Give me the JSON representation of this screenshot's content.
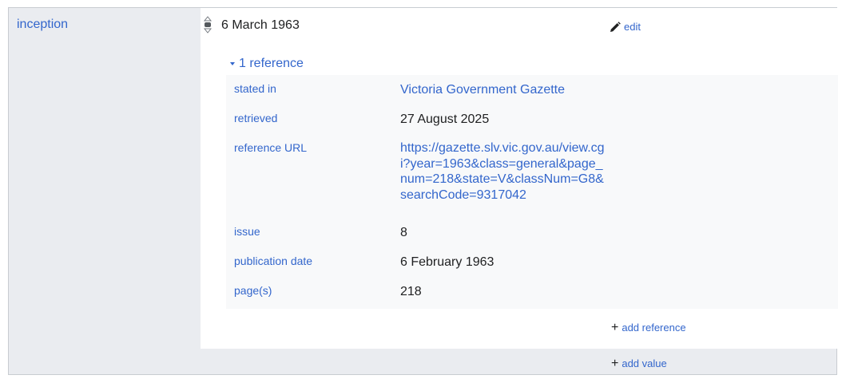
{
  "property": {
    "label": "inception"
  },
  "statement": {
    "value": "6 March 1963",
    "edit_label": "edit"
  },
  "references": {
    "toggle_label": "1 reference",
    "snaks": [
      {
        "property": "stated in",
        "value": "Victoria Government Gazette"
      },
      {
        "property": "retrieved",
        "value": "27 August 2025"
      },
      {
        "property": "reference URL",
        "value": "https://gazette.slv.vic.gov.au/view.cgi?year=1963&class=general&page_num=218&state=V&classNum=G8&searchCode=9317042"
      },
      {
        "property": "issue",
        "value": "8"
      },
      {
        "property": "publication date",
        "value": "6 February 1963"
      },
      {
        "property": "page(s)",
        "value": "218"
      }
    ],
    "add_reference_label": "add reference"
  },
  "add_value_label": "add value",
  "colors": {
    "link": "#3366cc",
    "panel": "#eaecf0",
    "ref_bg": "#f8f9fa",
    "border": "#c8ccd1"
  }
}
